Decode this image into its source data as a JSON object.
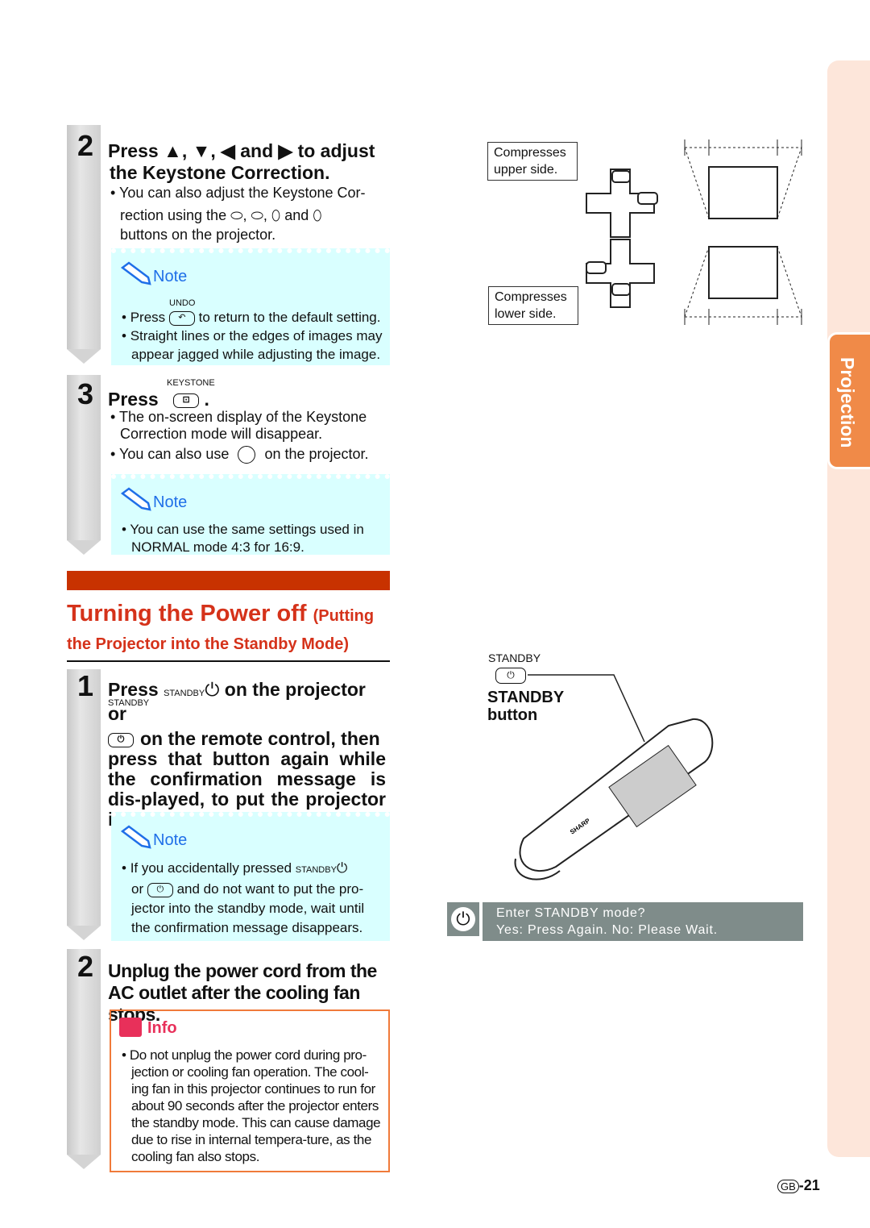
{
  "step2": {
    "number": "2",
    "heading_l1": "Press ▲, ▼, ◀ and ▶ to adjust",
    "heading_l2": "the Keystone Correction.",
    "b1_l1": "You can also adjust the Keystone Cor-",
    "b1_l2a": "rection using the",
    "b1_and": "and",
    "b1_l3": "buttons on the projector.",
    "note": {
      "title": "Note",
      "undo": "UNDO",
      "n1a": "Press",
      "n1b": "to return to the default setting.",
      "n2": "Straight lines or the edges of images may appear jagged while adjusting the image."
    }
  },
  "step3": {
    "number": "3",
    "press": "Press",
    "keystone": "KEYSTONE",
    "b1": "The on-screen display of the Keystone Correction mode will disappear.",
    "b2a": "You can also use",
    "b2b": "on the projector.",
    "note": {
      "title": "Note",
      "n1": "You can use the same settings used in NORMAL mode 4:3 for 16:9."
    }
  },
  "section": {
    "title": "Turning the Power off",
    "subtitle_a": "(Putting",
    "subtitle_b": "the Projector into the Standby Mode)",
    "accent": "#c83200"
  },
  "pstep1": {
    "number": "1",
    "press": "Press",
    "standby": "STANDBY",
    "h1": "on the projector or",
    "h2": "on the remote control, then",
    "h3": "press that button again while the confirmation message is dis-played, to put the projector into the standby mode.",
    "note": {
      "title": "Note",
      "n1a": "If you accidentally pressed",
      "n1b": "or",
      "n1c": "and do not want to put the pro-jector into the standby mode, wait until the confirmation message disappears."
    }
  },
  "pstep2": {
    "number": "2",
    "heading": "Unplug the power cord from the AC outlet after the cooling fan stops.",
    "info": {
      "title": "Info",
      "text": "Do not unplug the power cord during pro-jection or cooling fan operation. The cool-ing fan in this projector continues to run for about 90 seconds after the projector enters the standby mode. This can cause damage due to rise in internal tempera-ture, as the cooling fan also stops."
    }
  },
  "diagram": {
    "upper": "Compresses upper side.",
    "lower": "Compresses lower side."
  },
  "remote": {
    "standby_small": "STANDBY",
    "label_l1": "STANDBY",
    "label_l2": "button",
    "brand": "SHARP"
  },
  "osd": {
    "line1": "Enter STANDBY mode?",
    "line2": "Yes: Press Again.  No: Please Wait."
  },
  "side_tab": {
    "label": "Projection",
    "color": "#f08a48"
  },
  "page": {
    "region": "GB",
    "number": "-21"
  }
}
